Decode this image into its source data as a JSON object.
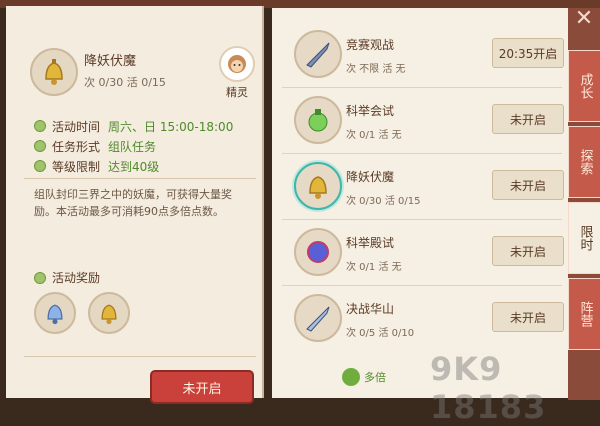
{
  "detail": {
    "title": "降妖伏魔",
    "counts": "次 0/30  活 0/15",
    "elf_label": "精灵",
    "info": [
      {
        "label": "活动时间",
        "value": "周六、日  15:00-18:00"
      },
      {
        "label": "任务形式",
        "value": "组队任务"
      },
      {
        "label": "等级限制",
        "value": "达到40级"
      }
    ],
    "description": "组队封印三界之中的妖魔，可获得大量奖励。本活动最多可消耗90点多倍点数。",
    "reward_label": "活动奖励",
    "start_button": "未开启"
  },
  "activities": [
    {
      "name": "竞赛观战",
      "stats": "次  不限   活  无",
      "button": "20:35开启",
      "icon": "sword-icon"
    },
    {
      "name": "科举会试",
      "stats": "次  0/1    活  无",
      "button": "未开启",
      "icon": "potion-icon"
    },
    {
      "name": "降妖伏魔",
      "stats": "次  0/30   活  0/15",
      "button": "未开启",
      "icon": "bell-icon"
    },
    {
      "name": "科举殿试",
      "stats": "次  0/1    活  无",
      "button": "未开启",
      "icon": "orb-icon"
    },
    {
      "name": "决战华山",
      "stats": "次  0/5    活  0/10",
      "button": "未开启",
      "icon": "sword-icon"
    }
  ],
  "multiplier_label": "多倍",
  "tabs": [
    "成长",
    "探索",
    "限时",
    "阵营"
  ],
  "watermark": "9K9 18183"
}
